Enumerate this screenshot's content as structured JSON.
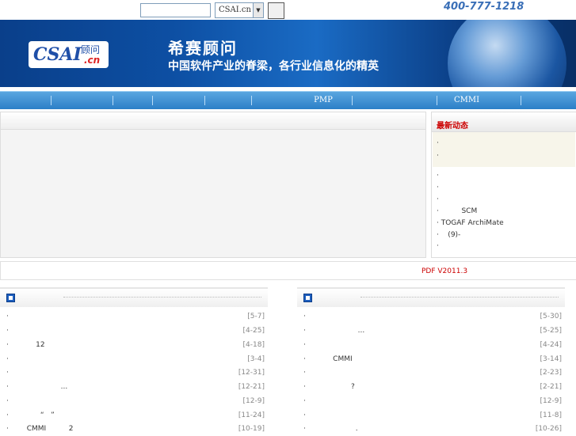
{
  "topbar": {
    "search_value": "",
    "site_select": "CSAI.cn",
    "phone": "400-777-1218"
  },
  "banner": {
    "logo_text": "CSAI",
    "logo_cn": "顾问",
    "logo_domain": ".cn",
    "title": "希赛顾问",
    "slogan": "中国软件产业的脊梁，各行业信息化的精英"
  },
  "nav": {
    "items": [
      "",
      "",
      "",
      "",
      "",
      "PMP",
      "",
      "CMMI",
      ""
    ]
  },
  "side": {
    "title": "最新动态",
    "items": [
      "·",
      "·",
      "·",
      "·",
      "·",
      "·          SCM",
      "· TOGAF ArchiMate",
      "·    (9)-",
      "·"
    ]
  },
  "pdf_line": "PDF  V2011.3",
  "news_left": {
    "rows": [
      {
        "title": "",
        "date": "[5-7]"
      },
      {
        "title": "",
        "date": "[4-25]"
      },
      {
        "title": "      12",
        "date": "[4-18]"
      },
      {
        "title": "",
        "date": "[3-4]"
      },
      {
        "title": "",
        "date": "[12-31]"
      },
      {
        "title": "                 ...",
        "date": "[12-21]"
      },
      {
        "title": "",
        "date": "[12-9]"
      },
      {
        "title": "        “   ”",
        "date": "[11-24]"
      },
      {
        "title": "  CMMI          2",
        "date": "[10-19]"
      }
    ]
  },
  "news_right": {
    "rows": [
      {
        "title": "",
        "date": "[5-30]"
      },
      {
        "title": "                 ...",
        "date": "[5-25]"
      },
      {
        "title": "",
        "date": "[4-24]"
      },
      {
        "title": "      CMMI",
        "date": "[3-14]"
      },
      {
        "title": "",
        "date": "[2-23]"
      },
      {
        "title": "              ?",
        "date": "[2-21]"
      },
      {
        "title": "",
        "date": "[12-9]"
      },
      {
        "title": "",
        "date": "[11-8]"
      },
      {
        "title": "                .",
        "date": "[10-26]"
      }
    ]
  }
}
